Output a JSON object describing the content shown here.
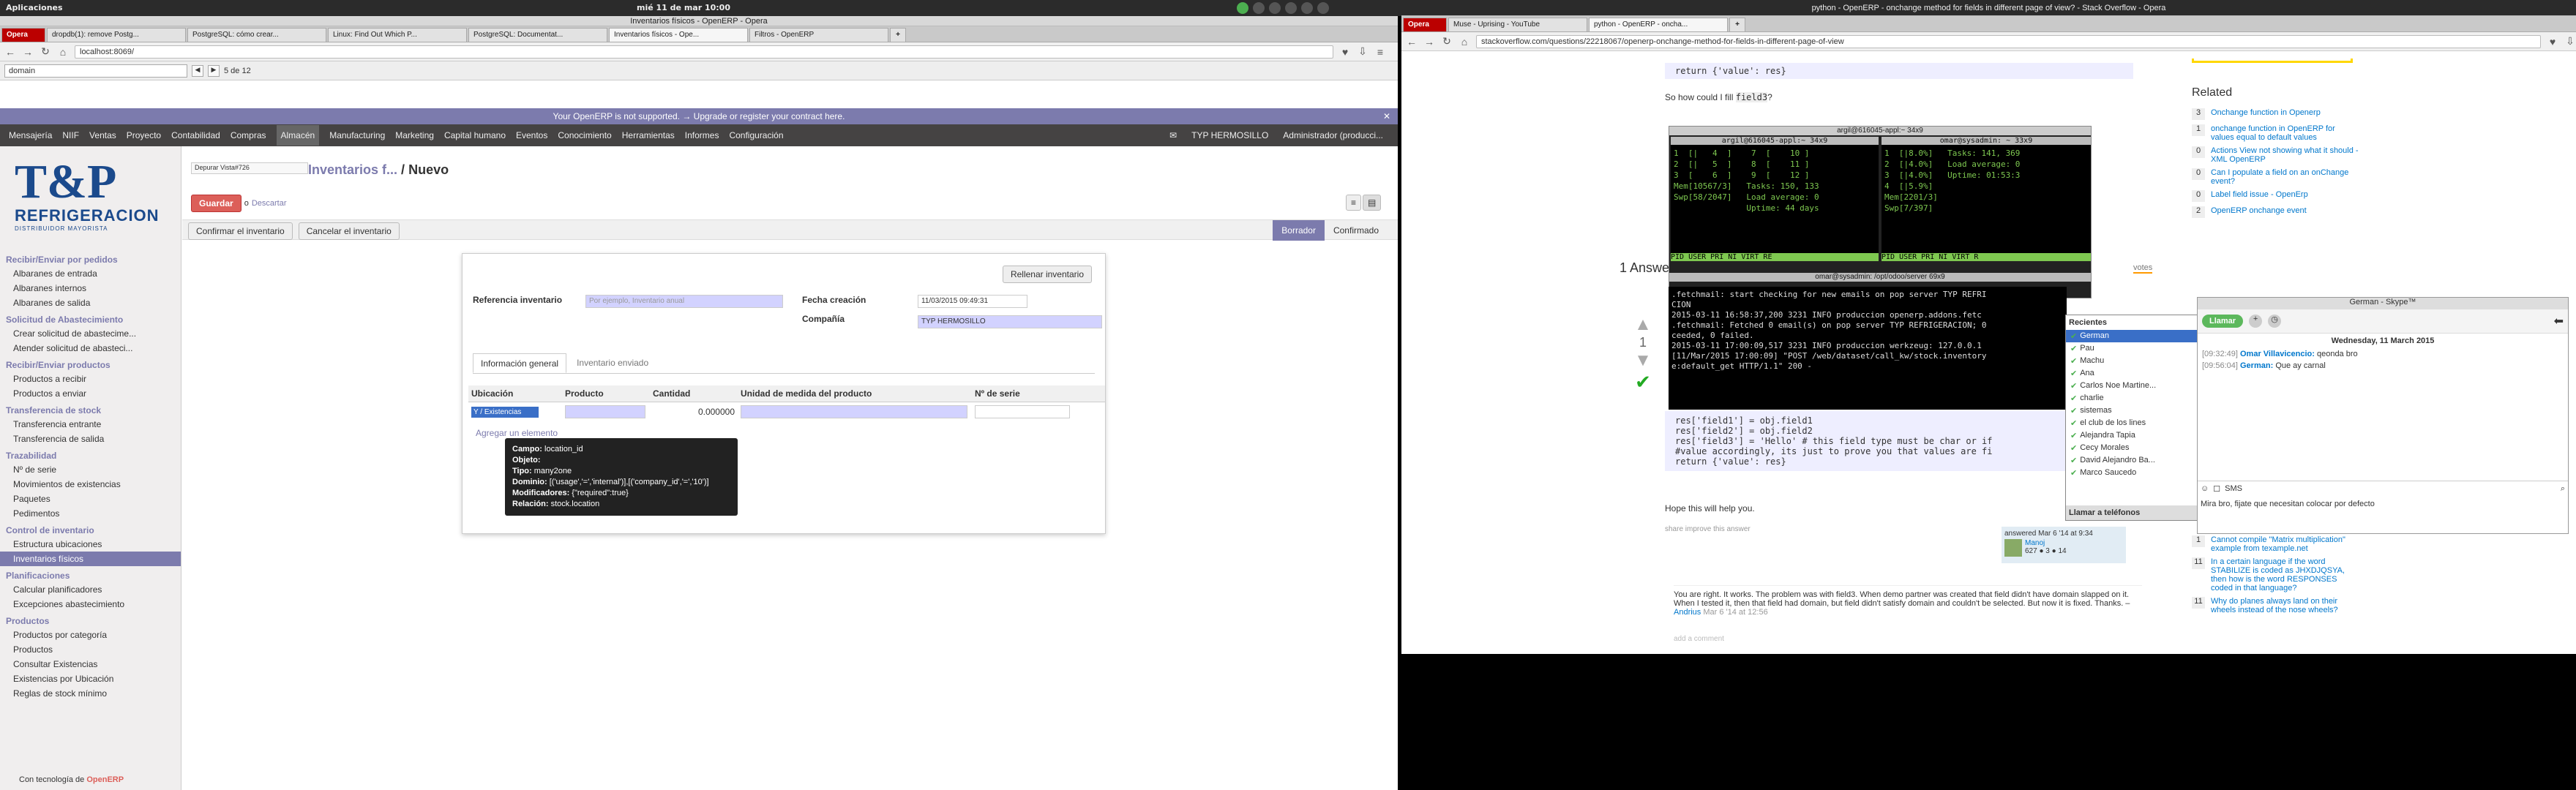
{
  "gnome": {
    "apps": "Aplicaciones",
    "clock": "mié 11 de mar 10:00"
  },
  "left": {
    "title": "Inventarios físicos - OpenERP - Opera",
    "tabs": [
      "Opera",
      "dropdb(1): remove Postg...",
      "PostgreSQL: cómo crear...",
      "Linux: Find Out Which P...",
      "PostgreSQL: Documentat...",
      "Inventarios físicos - Ope...",
      "Filtros - OpenERP"
    ],
    "url": "localhost:8069/",
    "find": {
      "value": "domain",
      "count": "5 de 12"
    },
    "warning": "Your OpenERP is not supported. → Upgrade or register your contract here.",
    "menu": [
      "Mensajería",
      "NIIF",
      "Ventas",
      "Proyecto",
      "Contabilidad",
      "Compras",
      "Almacén",
      "Manufacturing",
      "Marketing",
      "Capital humano",
      "Eventos",
      "Conocimiento",
      "Herramientas",
      "Informes",
      "Configuración"
    ],
    "company": "TYP HERMOSILLO",
    "user": "Administrador (producci...",
    "logo": {
      "line1": "T&P",
      "line2": "REFRIGERACION",
      "line3": "DISTRIBUIDOR MAYORISTA"
    },
    "sidebar": [
      {
        "h": "Recibir/Enviar por pedidos",
        "items": [
          "Albaranes de entrada",
          "Albaranes internos",
          "Albaranes de salida"
        ]
      },
      {
        "h": "Solicitud de Abastecimiento",
        "items": [
          "Crear solicitud de abastecime...",
          "Atender solicitud de abasteci..."
        ]
      },
      {
        "h": "Recibir/Enviar productos",
        "items": [
          "Productos a recibir",
          "Productos a enviar"
        ]
      },
      {
        "h": "Transferencia de stock",
        "items": [
          "Transferencia entrante",
          "Transferencia de salida"
        ]
      },
      {
        "h": "Trazabilidad",
        "items": [
          "Nº de serie",
          "Movimientos de existencias",
          "Paquetes",
          "Pedimentos"
        ]
      },
      {
        "h": "Control de inventario",
        "items": [
          "Estructura ubicaciones",
          "Inventarios físicos"
        ]
      },
      {
        "h": "Planificaciones",
        "items": [
          "Calcular planificadores",
          "Excepciones abastecimiento"
        ]
      },
      {
        "h": "Productos",
        "items": [
          "Productos por categoría",
          "Productos",
          "Consultar Existencias",
          "Existencias por Ubicación",
          "Reglas de stock mínimo"
        ]
      }
    ],
    "footer_prefix": "Con tecnología de",
    "footer_brand": "OpenERP",
    "debug": "Depurar Vista#726",
    "breadcrumb_parent": "Inventarios f...",
    "breadcrumb_current": "Nuevo",
    "save": "Guardar",
    "or": "o",
    "discard": "Descartar",
    "confirm": "Confirmar el inventario",
    "cancel": "Cancelar el inventario",
    "states": [
      "Borrador",
      "Confirmado"
    ],
    "fill": "Rellenar inventario",
    "ref_label": "Referencia inventario",
    "ref_placeholder": "Por ejemplo, Inventario anual",
    "date_label": "Fecha creación",
    "date_value": "11/03/2015 09:49:31",
    "company_label": "Compañía",
    "company_value": "TYP HERMOSILLO",
    "tabs2": [
      "Información general",
      "Inventario enviado"
    ],
    "cols": [
      "Ubicación",
      "Producto",
      "Cantidad",
      "Unidad de medida del producto",
      "Nº de serie"
    ],
    "row": {
      "loc": "Y / Existencias",
      "qty": "0.000000"
    },
    "add": "Agregar un elemento",
    "tip": [
      [
        "Campo:",
        "location_id"
      ],
      [
        "Objeto:",
        ""
      ],
      [
        "Tipo:",
        "many2one"
      ],
      [
        "Dominio:",
        "[('usage','=','internal')],[('company_id','=','10')]"
      ],
      [
        "Modificadores:",
        "{\"required\":true}"
      ],
      [
        "Relación:",
        "stock.location"
      ]
    ]
  },
  "right": {
    "title": "python - OpenERP - onchange method for fields in different page of view? - Stack Overflow - Opera",
    "tabs": [
      "Opera",
      "Muse - Uprising - YouTube",
      "python - OpenERP - oncha..."
    ],
    "url": "stackoverflow.com/questions/22218067/openerp-onchange-method-for-fields-in-different-page-of-view",
    "code_top": "return {'value': res}",
    "q_text": "So how could I fill",
    "q_code": "field3",
    "q_end": "?",
    "answers": "1 Answer",
    "votes": "votes",
    "vote_count": "1",
    "code": [
      "res['field1'] = obj.field1",
      "res['field2'] = obj.field2",
      "res['field3'] = 'Hello' # this field type must be char or if",
      "#value accordingly, its just to prove you that values are fi",
      "return {'value': res}"
    ],
    "help": "Hope this will help you.",
    "share": "share  improve this answer",
    "answered": "answered Mar 6 '14 at 9:34",
    "user": "Manoj",
    "rep": "627 ● 3 ● 14",
    "comment": "You are right. It works. The problem was with field3. When demo partner was created that field didn't have domain slapped on it. When I tested it, then that field had domain, but field didn't satisfy domain and couldn't be selected. But now it is fixed. Thanks. –",
    "comment_user": "Andrius",
    "comment_date": "Mar 6 '14 at 12:56",
    "add_comment": "add a comment",
    "related_title": "Related",
    "related": [
      [
        "3",
        "Onchange function in Openerp"
      ],
      [
        "1",
        "onchange function in OpenERP for values equal to default values"
      ],
      [
        "0",
        "Actions View not showing what it should - XML OpenERP"
      ],
      [
        "0",
        "Can I populate a field on an onChange event?"
      ],
      [
        "0",
        "Label field issue - OpenErp"
      ],
      [
        "2",
        "OpenERP onchange event"
      ]
    ],
    "related2": [
      [
        "1",
        "Cannot compile \"Matrix multiplication\" example from texample.net"
      ],
      [
        "11",
        "In a certain language if the word STABILIZE is coded as JHXDJQSYA, then how is the word RESPONSES coded in that language?"
      ],
      [
        "11",
        "Why do planes always land on their wheels instead of the nose wheels?"
      ]
    ]
  },
  "terminal": {
    "title": "argil@616045-appl:~ 34x9",
    "pane1": "argil@616045-appl:~ 34x9",
    "pane2": "omar@sysadmin: ~ 33x9",
    "p1": [
      "1  [|   4  ]    7  [    10 ]",
      "2  [|   5  ]    8  [    11 ]",
      "3  [    6  ]    9  [    12 ]",
      "Mem[10567/3]   Tasks: 150, 133",
      "Swp[58/2047]   Load average: 0",
      "               Uptime: 44 days"
    ],
    "p2": [
      "1  [|8.0%]   Tasks: 141, 369",
      "2  [|4.0%]   Load average: 0",
      "3  [|4.0%]   Uptime: 01:53:3",
      "4  [|5.9%]",
      "Mem[2201/3]",
      "Swp[7/397]"
    ],
    "bar1": "PID USER        PRI  NI  VIRT  RE",
    "bar2": "PID USER     PRI  NI  VIRT  R",
    "bottom_title": "omar@sysadmin: /opt/odoo/server 69x9",
    "log": [
      ".fetchmail: start checking for new emails on pop server TYP REFRI",
      "CION",
      "2015-03-11 16:58:37,200 3231 INFO produccion openerp.addons.fetc",
      ".fetchmail: Fetched 0 email(s) on pop server TYP REFRIGERACION; 0",
      "ceeded, 0 failed.",
      "2015-03-11 17:00:09,517 3231 INFO produccion werkzeug: 127.0.0.1",
      "[11/Mar/2015 17:00:09] \"POST /web/dataset/call_kw/stock.inventory",
      "e:default_get HTTP/1.1\" 200 -"
    ]
  },
  "contacts": {
    "title": "Recientes",
    "items": [
      "German",
      "Pau",
      "Machu",
      "Ana",
      "Carlos Noe Martine...",
      "charlie",
      "sistemas",
      "el club de los lines",
      "Alejandra Tapia",
      "Cecy Morales",
      "David Alejandro Ba...",
      "Marco Saucedo"
    ],
    "call": "Llamar a teléfonos"
  },
  "skype": {
    "title": "German - Skype™",
    "call": "Llamar",
    "date": "Wednesday, 11 March 2015",
    "msgs": [
      [
        "[09:32:49]",
        "Omar Villavicencio:",
        "qeonda bro"
      ],
      [
        "[09:56:04]",
        "German:",
        "Que ay carnal"
      ]
    ],
    "sms": "SMS",
    "input": "Mira bro, fijate que necesitan colocar por defecto"
  },
  "colors": {
    "oe_purple": "#7c7bad",
    "oe_dark": "#454343",
    "save_red": "#dc5f59",
    "opera_red": "#b00",
    "term_green": "#7ec850"
  }
}
